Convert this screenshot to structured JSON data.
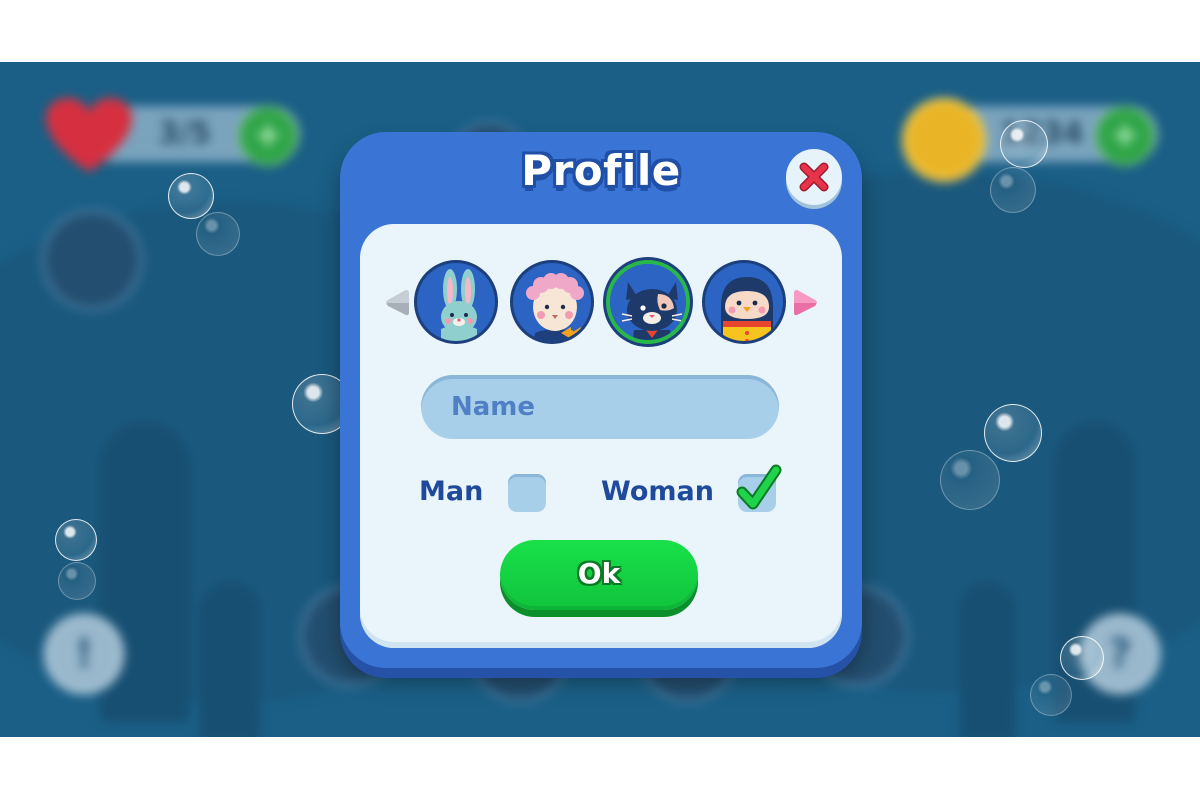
{
  "dialog": {
    "title": "Profile",
    "close_icon": "close-x-icon",
    "avatars": [
      {
        "name": "bunny",
        "selected": false
      },
      {
        "name": "sheep",
        "selected": false
      },
      {
        "name": "cat",
        "selected": true
      },
      {
        "name": "penguin",
        "selected": false
      }
    ],
    "prev_icon": "arrow-left-icon",
    "next_icon": "arrow-right-icon",
    "name_placeholder": "Name",
    "gender": {
      "man_label": "Man",
      "man_checked": false,
      "woman_label": "Woman",
      "woman_checked": true
    },
    "ok_label": "Ok"
  },
  "background_hud": {
    "lives": "3/5",
    "coins": "1234",
    "info_button": "!",
    "help_button": "?"
  },
  "colors": {
    "dialog_blue": "#3a74d4",
    "panel": "#e9f4fb",
    "ok_green": "#14d443",
    "close_red": "#e8344a",
    "scene": "#1b5f86"
  }
}
